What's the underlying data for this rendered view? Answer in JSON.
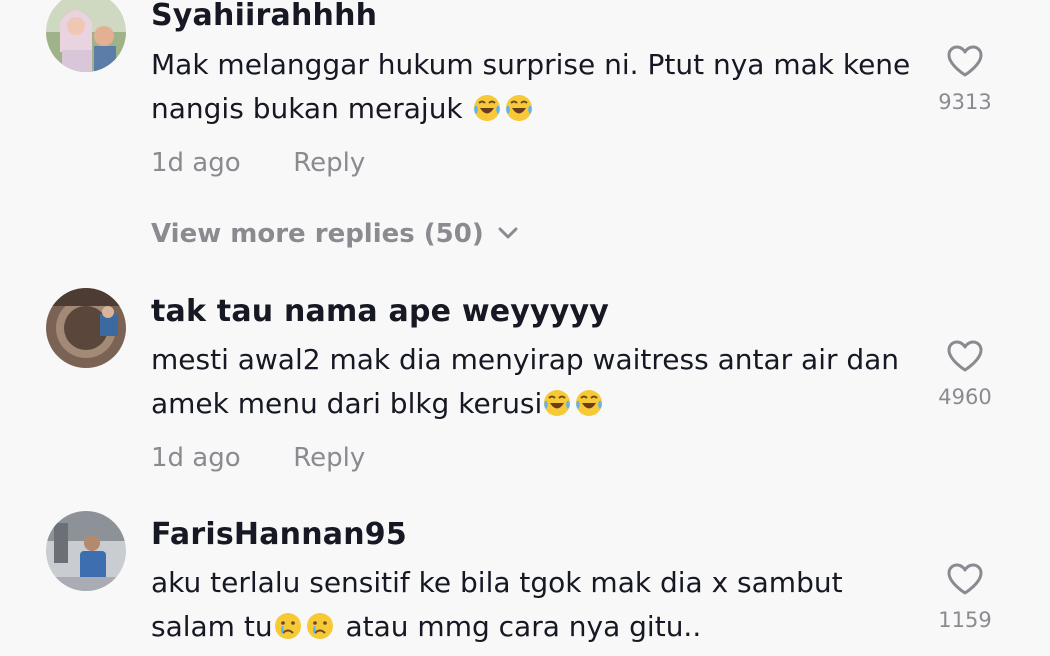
{
  "comments": [
    {
      "username": "Syahiirahhhh",
      "text": "Mak melanggar hukum surprise ni. Ptut nya mak kene nangis bukan merajuk",
      "emojis": [
        "face-with-tears-of-joy",
        "face-with-tears-of-joy"
      ],
      "time": "1d ago",
      "reply_label": "Reply",
      "likes": "9313"
    },
    {
      "username": "tak tau nama ape weyyyyy",
      "text": "mesti awal2 mak dia menyirap waitress antar air dan amek menu dari blkg kerusi",
      "emojis": [
        "face-with-tears-of-joy",
        "face-with-tears-of-joy"
      ],
      "time": "1d ago",
      "reply_label": "Reply",
      "likes": "4960"
    },
    {
      "username": "FarisHannan95",
      "text_before": "aku terlalu sensitif ke bila tgok mak dia x sambut salam tu",
      "emojis": [
        "crying-face",
        "crying-face"
      ],
      "text_after": " atau mmg cara nya gitu..",
      "likes": "1159"
    }
  ],
  "view_more_replies": "View more replies (50)",
  "icons": {
    "like": "heart-outline-icon",
    "expand": "chevron-down-icon"
  },
  "colors": {
    "background": "#f8f8f8",
    "primary_text": "#161823",
    "secondary_text": "#8a8b91"
  }
}
